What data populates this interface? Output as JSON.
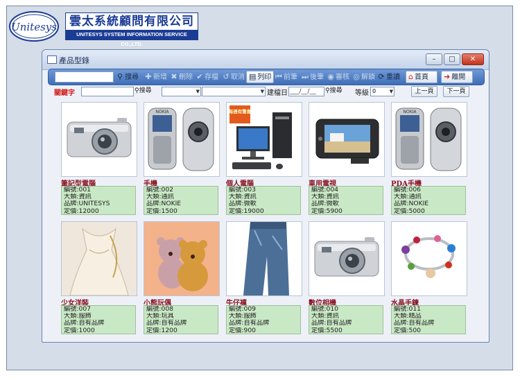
{
  "brand": {
    "logo_text": "Unitesys",
    "company_name": "雲太系統顧問有限公司",
    "company_en": "UNITESYS SYSTEM INFORMATION SERVICE CO.,LTD."
  },
  "window": {
    "title": "產品型錄",
    "minimize": "–",
    "maximize": "□",
    "close": "✕"
  },
  "toolbar": {
    "search": "搜尋",
    "add": "新增",
    "delete": "刪除",
    "save": "存檔",
    "cancel": "取消",
    "print": "列印",
    "prev": "前筆",
    "next": "後筆",
    "audit": "審核",
    "unlock": "解鎖",
    "refresh": "重讀",
    "home": "首頁",
    "exit": "離開"
  },
  "filter": {
    "keyword_label": "關鍵字",
    "search": "搜尋",
    "date_label": "建檔日",
    "date_value": "___/__/__",
    "search2": "搜尋",
    "level_label": "等級",
    "level_value": "0",
    "prev_page": "上一頁",
    "next_page": "下一頁"
  },
  "products": [
    {
      "name": "筆記型電腦",
      "line1": "編號:001",
      "line2": "大類:資訊",
      "line3": "品牌:UNITESYS",
      "line4": "定價:12000",
      "image": "camera"
    },
    {
      "name": "手機",
      "line1": "編號:002",
      "line2": "大類:通訊",
      "line3": "品牌:NOKIE",
      "line4": "定價:1500",
      "image": "phone"
    },
    {
      "name": "個人電腦",
      "line1": "編號:003",
      "line2": "大類:資訊",
      "line3": "品牌:微軟",
      "line4": "定價:19000",
      "image": "pc",
      "badge": "每週有驚喜"
    },
    {
      "name": "車用電視",
      "line1": "編號:004",
      "line2": "大類:資訊",
      "line3": "品牌:微軟",
      "line4": "定價:5900",
      "image": "car-tv"
    },
    {
      "name": "PDA手機",
      "line1": "編號:006",
      "line2": "大類:通訊",
      "line3": "品牌:NOKIE",
      "line4": "定價:5000",
      "image": "phone"
    },
    {
      "name": "少女洋裝",
      "line1": "編號:007",
      "line2": "大類:服飾",
      "line3": "品牌:自有品牌",
      "line4": "定價:1000",
      "image": "dress"
    },
    {
      "name": "小熊玩偶",
      "line1": "編號:008",
      "line2": "大類:玩具",
      "line3": "品牌:自有品牌",
      "line4": "定價:1200",
      "image": "bears"
    },
    {
      "name": "牛仔褲",
      "line1": "編號:009",
      "line2": "大類:服飾",
      "line3": "品牌:自有品牌",
      "line4": "定價:900",
      "image": "jeans"
    },
    {
      "name": "數位相機",
      "line1": "編號:010",
      "line2": "大類:資訊",
      "line3": "品牌:自有品牌",
      "line4": "定價:5500",
      "image": "camera"
    },
    {
      "name": "水晶手鍊",
      "line1": "編號:011",
      "line2": "大類:精品",
      "line3": "品牌:自有品牌",
      "line4": "定價:500",
      "image": "bracelet"
    }
  ]
}
